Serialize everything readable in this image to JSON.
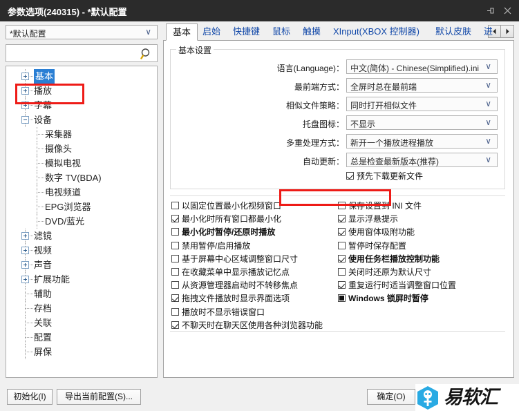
{
  "window": {
    "title": "参数选项(240315) - *默认配置",
    "controls": [
      {
        "name": "pin-icon",
        "label": "固定"
      },
      {
        "name": "close-icon",
        "label": "关闭"
      }
    ]
  },
  "sidebar": {
    "profile_combo": {
      "value": "*默认配置",
      "arrow": "∨"
    },
    "search": {
      "value": "",
      "placeholder": "",
      "icon": "search-icon"
    },
    "tree": [
      {
        "label": "基本",
        "level": 0,
        "expander": "plus",
        "selected": true
      },
      {
        "label": "播放",
        "level": 0,
        "expander": "plus",
        "selected": false
      },
      {
        "label": "字幕",
        "level": 0,
        "expander": "plus",
        "selected": false
      },
      {
        "label": "设备",
        "level": 0,
        "expander": "minus",
        "selected": false
      },
      {
        "label": "采集器",
        "level": 1,
        "expander": "none",
        "selected": false
      },
      {
        "label": "摄像头",
        "level": 1,
        "expander": "none",
        "selected": false
      },
      {
        "label": "模拟电视",
        "level": 1,
        "expander": "none",
        "selected": false
      },
      {
        "label": "数字 TV(BDA)",
        "level": 1,
        "expander": "none",
        "selected": false
      },
      {
        "label": "电视频道",
        "level": 1,
        "expander": "none",
        "selected": false
      },
      {
        "label": "EPG浏览器",
        "level": 1,
        "expander": "none",
        "selected": false
      },
      {
        "label": "DVD/蓝光",
        "level": 1,
        "expander": "none",
        "selected": false
      },
      {
        "label": "滤镜",
        "level": 0,
        "expander": "plus",
        "selected": false
      },
      {
        "label": "视频",
        "level": 0,
        "expander": "plus",
        "selected": false
      },
      {
        "label": "声音",
        "level": 0,
        "expander": "plus",
        "selected": false
      },
      {
        "label": "扩展功能",
        "level": 0,
        "expander": "plus",
        "selected": false
      },
      {
        "label": "辅助",
        "level": 0,
        "expander": "none",
        "selected": false
      },
      {
        "label": "存档",
        "level": 0,
        "expander": "none",
        "selected": false
      },
      {
        "label": "关联",
        "level": 0,
        "expander": "none",
        "selected": false
      },
      {
        "label": "配置",
        "level": 0,
        "expander": "none",
        "selected": false
      },
      {
        "label": "屏保",
        "level": 0,
        "expander": "none",
        "selected": false
      }
    ]
  },
  "tabs": {
    "items": [
      {
        "label": "基本",
        "active": true
      },
      {
        "label": "启始",
        "active": false
      },
      {
        "label": "快捷键",
        "active": false
      },
      {
        "label": "鼠标",
        "active": false
      },
      {
        "label": "触摸",
        "active": false
      },
      {
        "label": "XInput(XBOX 控制器)",
        "active": false
      },
      {
        "label": "默认皮肤",
        "active": false
      },
      {
        "label": "进",
        "active": false
      }
    ],
    "scroll_left": "◄",
    "scroll_right": "►"
  },
  "settings": {
    "group_title": "基本设置",
    "rows": [
      {
        "label": "语言(Language)：",
        "value": "中文(简体) - Chinese(Simplified).ini",
        "arrow": "∨"
      },
      {
        "label": "最前端方式：",
        "value": "全屏时总在最前端",
        "arrow": "∨"
      },
      {
        "label": "相似文件策略：",
        "value": "同时打开相似文件",
        "arrow": "∨"
      },
      {
        "label": "托盘图标：",
        "value": "不显示",
        "arrow": "∨"
      },
      {
        "label": "多重处理方式：",
        "value": "新开一个播放进程播放",
        "arrow": "∨"
      },
      {
        "label": "自动更新：",
        "value": "总是检查最新版本(推荐)",
        "arrow": "∨"
      }
    ],
    "predownload": {
      "label": "预先下载更新文件",
      "state": "checked"
    }
  },
  "checkboxes_left": [
    {
      "label": "以固定位置最小化视频窗口",
      "state": "unchecked",
      "bold": false
    },
    {
      "label": "最小化时所有窗口都最小化",
      "state": "checked",
      "bold": false
    },
    {
      "label": "最小化时暂停/还原时播放",
      "state": "unchecked",
      "bold": true
    },
    {
      "label": "禁用暂停/启用播放",
      "state": "unchecked",
      "bold": false
    },
    {
      "label": "基于屏幕中心区域调整窗口尺寸",
      "state": "unchecked",
      "bold": false
    },
    {
      "label": "在收藏菜单中显示播放记忆点",
      "state": "unchecked",
      "bold": false
    },
    {
      "label": "从资源管理器启动时不转移焦点",
      "state": "unchecked",
      "bold": false
    },
    {
      "label": "拖拽文件播放时显示界面选项",
      "state": "checked",
      "bold": false
    },
    {
      "label": "播放时不显示错误窗口",
      "state": "unchecked",
      "bold": false
    },
    {
      "label": "不聊天时在聊天区使用各种浏览器功能",
      "state": "checked",
      "bold": false
    }
  ],
  "checkboxes_right": [
    {
      "label": "保存设置到 INI 文件",
      "state": "unchecked",
      "bold": false
    },
    {
      "label": "显示浮悬提示",
      "state": "checked",
      "bold": false
    },
    {
      "label": "使用窗体吸附功能",
      "state": "checked",
      "bold": false
    },
    {
      "label": "暂停时保存配置",
      "state": "unchecked",
      "bold": false
    },
    {
      "label": "使用任务栏播放控制功能",
      "state": "checked",
      "bold": true
    },
    {
      "label": "关闭时还原为默认尺寸",
      "state": "unchecked",
      "bold": false
    },
    {
      "label": "重复运行时适当调整窗口位置",
      "state": "checked",
      "bold": false
    },
    {
      "label": "Windows 锁屏时暂停",
      "state": "filled",
      "bold": true
    }
  ],
  "footer": {
    "init_button": "初始化(I)",
    "export_button": "导出当前配置(S)...",
    "ok_button": "确定(O)"
  },
  "watermark": {
    "text": "易软汇"
  },
  "annotations": {
    "colors": {
      "highlight": "#ee1b17",
      "accent": "#1047a8",
      "selection": "#2a7fd4"
    }
  }
}
